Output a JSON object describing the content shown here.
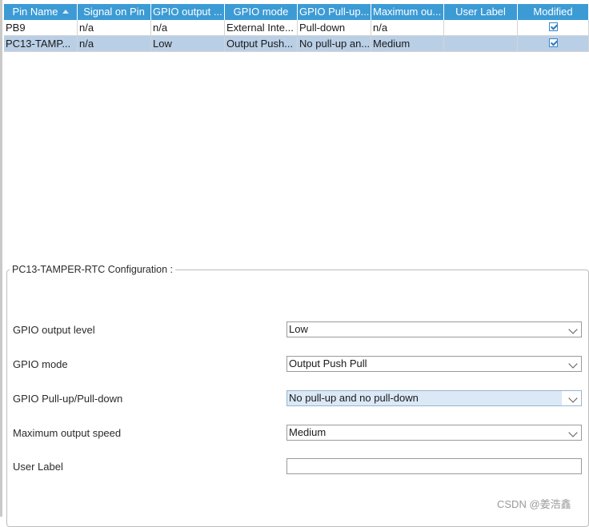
{
  "table": {
    "headers": [
      "Pin Name",
      "Signal on Pin",
      "GPIO output ...",
      "GPIO mode",
      "GPIO Pull-up...",
      "Maximum ou...",
      "User Label",
      "Modified"
    ],
    "rows": [
      {
        "pin": "PB9",
        "signal": "n/a",
        "output": "n/a",
        "mode": "External Inte...",
        "pull": "Pull-down",
        "speed": "n/a",
        "label": "",
        "modified": true
      },
      {
        "pin": "PC13-TAMP...",
        "signal": "n/a",
        "output": "Low",
        "mode": "Output Push...",
        "pull": "No pull-up an...",
        "speed": "Medium",
        "label": "",
        "modified": true
      }
    ],
    "selected_row": 1
  },
  "config": {
    "title": "PC13-TAMPER-RTC Configuration :",
    "fields": [
      {
        "label": "GPIO output level",
        "value": "Low"
      },
      {
        "label": "GPIO mode",
        "value": "Output Push Pull"
      },
      {
        "label": "GPIO Pull-up/Pull-down",
        "value": "No pull-up and no pull-down"
      },
      {
        "label": "Maximum output speed",
        "value": "Medium"
      }
    ],
    "user_label": {
      "label": "User Label",
      "value": ""
    }
  },
  "watermark": "CSDN @姜浩鑫",
  "colors": {
    "header_bg": "#3c9bd5",
    "selected_row": "#b9cfe6",
    "focused_field": "#dbe8f5"
  }
}
